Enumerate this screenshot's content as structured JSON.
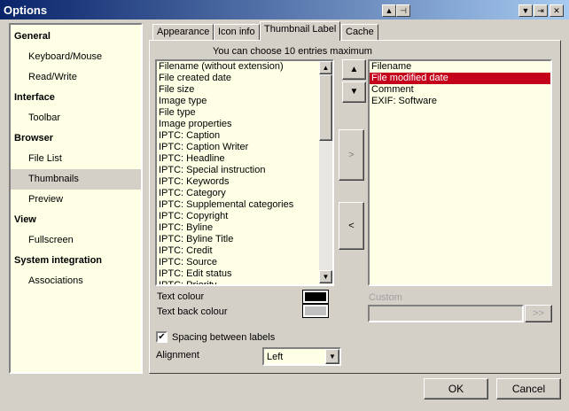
{
  "window": {
    "title": "Options"
  },
  "sidebar": {
    "items": [
      {
        "label": "General",
        "type": "h"
      },
      {
        "label": "Keyboard/Mouse",
        "type": "c"
      },
      {
        "label": "Read/Write",
        "type": "c"
      },
      {
        "label": "Interface",
        "type": "h"
      },
      {
        "label": "Toolbar",
        "type": "c"
      },
      {
        "label": "Browser",
        "type": "h"
      },
      {
        "label": "File List",
        "type": "c"
      },
      {
        "label": "Thumbnails",
        "type": "c",
        "selected": true
      },
      {
        "label": "Preview",
        "type": "c"
      },
      {
        "label": "View",
        "type": "h"
      },
      {
        "label": "Fullscreen",
        "type": "c"
      },
      {
        "label": "System integration",
        "type": "h"
      },
      {
        "label": "Associations",
        "type": "c"
      }
    ]
  },
  "tabs": [
    "Appearance",
    "Icon info",
    "Thumbnail Label",
    "Cache"
  ],
  "active_tab": 2,
  "hint": "You can choose 10 entries maximum",
  "available": [
    "Filename (without extension)",
    "File created date",
    "File size",
    "Image type",
    "File type",
    "Image properties",
    "IPTC: Caption",
    "IPTC: Caption Writer",
    "IPTC: Headline",
    "IPTC: Special instruction",
    "IPTC: Keywords",
    "IPTC: Category",
    "IPTC: Supplemental categories",
    "IPTC: Copyright",
    "IPTC: Byline",
    "IPTC: Byline Title",
    "IPTC: Credit",
    "IPTC: Source",
    "IPTC: Edit status",
    "IPTC: Priority"
  ],
  "selected_entries": [
    "Filename",
    "File modified date",
    "Comment",
    "EXIF: Software"
  ],
  "selected_index": 1,
  "buttons": {
    "add": ">",
    "remove": "<",
    "custom_add": ">>",
    "ok": "OK",
    "cancel": "Cancel"
  },
  "text_colour_label": "Text colour",
  "text_colour": "#000000",
  "back_colour_label": "Text back colour",
  "back_colour": "#c0c0c0",
  "custom_label": "Custom",
  "custom_value": "",
  "spacing_label": "Spacing between labels",
  "spacing_checked": true,
  "alignment_label": "Alignment",
  "alignment_value": "Left"
}
